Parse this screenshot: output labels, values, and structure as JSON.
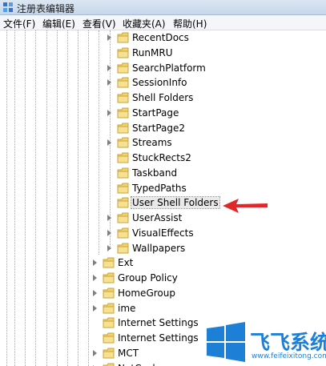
{
  "window": {
    "title": "注册表编辑器"
  },
  "menu": [
    {
      "label": "文件(F)"
    },
    {
      "label": "编辑(E)"
    },
    {
      "label": "查看(V)"
    },
    {
      "label": "收藏夹(A)"
    },
    {
      "label": "帮助(H)"
    }
  ],
  "tree": {
    "explorer_children": [
      {
        "label": "RecentDocs",
        "expandable": true
      },
      {
        "label": "RunMRU",
        "expandable": false
      },
      {
        "label": "SearchPlatform",
        "expandable": true
      },
      {
        "label": "SessionInfo",
        "expandable": true
      },
      {
        "label": "Shell Folders",
        "expandable": false
      },
      {
        "label": "StartPage",
        "expandable": true
      },
      {
        "label": "StartPage2",
        "expandable": false
      },
      {
        "label": "Streams",
        "expandable": true
      },
      {
        "label": "StuckRects2",
        "expandable": false
      },
      {
        "label": "Taskband",
        "expandable": false
      },
      {
        "label": "TypedPaths",
        "expandable": false
      },
      {
        "label": "User Shell Folders",
        "expandable": false,
        "selected": true
      },
      {
        "label": "UserAssist",
        "expandable": true
      },
      {
        "label": "VisualEffects",
        "expandable": true
      },
      {
        "label": "Wallpapers",
        "expandable": true
      }
    ],
    "siblings": [
      {
        "label": "Ext",
        "expandable": true
      },
      {
        "label": "Group Policy",
        "expandable": true
      },
      {
        "label": "HomeGroup",
        "expandable": true
      },
      {
        "label": "ime",
        "expandable": true
      },
      {
        "label": "Internet Settings",
        "expandable": false
      },
      {
        "label": "Internet Settings",
        "expandable": false
      },
      {
        "label": "MCT",
        "expandable": true
      },
      {
        "label": "NetCache",
        "expandable": true
      }
    ]
  },
  "watermark": {
    "brand": "飞飞系统",
    "url": "www.feifeixitong.com"
  },
  "colors": {
    "folder": "#f2d36b",
    "arrow": "#e0282a",
    "logo_blue": "#1e7fd6"
  }
}
